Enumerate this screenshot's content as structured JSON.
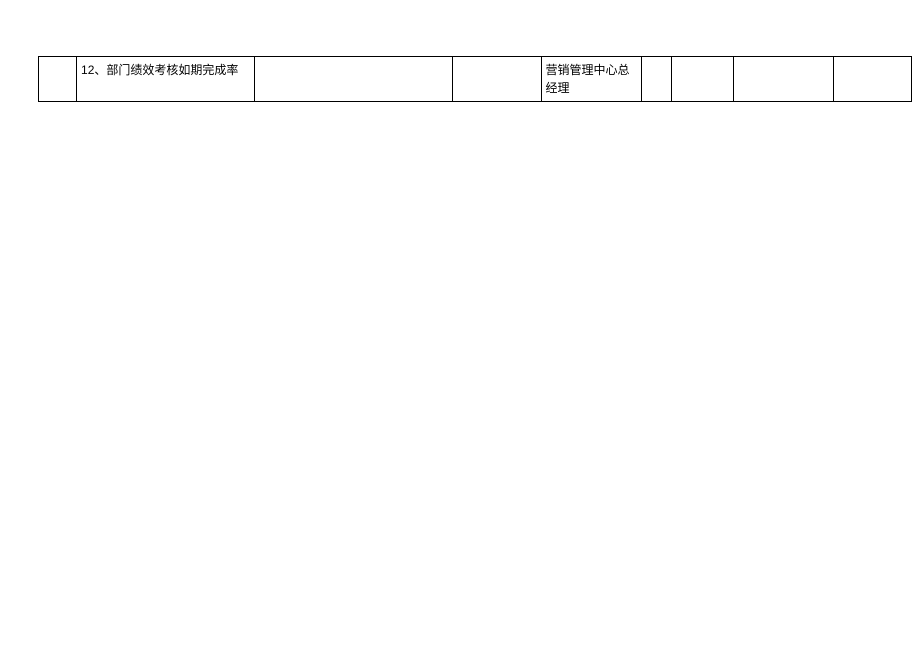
{
  "table": {
    "rows": [
      {
        "c1": "",
        "c2": "12、部门绩效考核如期完成率",
        "c3": "",
        "c4": "",
        "c5": "营销管理中心总经理",
        "c6": "",
        "c7": "",
        "c8": "",
        "c9": ""
      }
    ]
  }
}
